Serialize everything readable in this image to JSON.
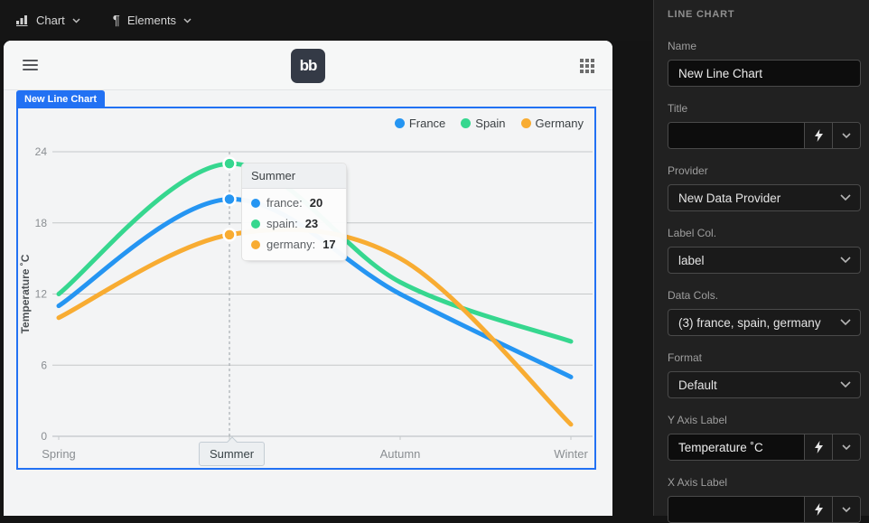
{
  "toolbar": {
    "chart_menu": "Chart",
    "elements_menu": "Elements"
  },
  "preview": {
    "logo_text": "bb"
  },
  "component": {
    "badge": "New Line Chart",
    "accent_color": "#2271f3"
  },
  "chart_data": {
    "type": "line",
    "categories": [
      "Spring",
      "Summer",
      "Autumn",
      "Winter"
    ],
    "series": [
      {
        "name": "France",
        "key": "france",
        "color": "#2595f2",
        "values": [
          11,
          20,
          12,
          5
        ]
      },
      {
        "name": "Spain",
        "key": "spain",
        "color": "#36d78f",
        "values": [
          12,
          23,
          13,
          8
        ]
      },
      {
        "name": "Germany",
        "key": "germany",
        "color": "#f8ac32",
        "values": [
          10,
          17,
          15,
          1
        ]
      }
    ],
    "title": "",
    "xlabel": "",
    "ylabel": "Temperature ˚C",
    "ylim": [
      0,
      24
    ],
    "yticks": [
      0,
      6,
      12,
      18,
      24
    ],
    "grid": true,
    "legend_position": "top-right",
    "curve": "smooth",
    "active_index": 1,
    "tooltip": {
      "title": "Summer",
      "rows": [
        {
          "label": "france:",
          "value": "20"
        },
        {
          "label": "spain:",
          "value": "23"
        },
        {
          "label": "germany:",
          "value": "17"
        }
      ]
    },
    "crosshair_label": "Summer"
  },
  "panel": {
    "title": "LINE CHART",
    "name": {
      "label": "Name",
      "value": "New Line Chart"
    },
    "title_field": {
      "label": "Title",
      "value": ""
    },
    "provider": {
      "label": "Provider",
      "value": "New Data Provider"
    },
    "label_col": {
      "label": "Label Col.",
      "value": "label"
    },
    "data_cols": {
      "label": "Data Cols.",
      "value": "(3) france, spain, germany"
    },
    "format": {
      "label": "Format",
      "value": "Default"
    },
    "y_axis": {
      "label": "Y Axis Label",
      "value": "Temperature ˚C"
    },
    "x_axis": {
      "label": "X Axis Label",
      "value": ""
    }
  }
}
